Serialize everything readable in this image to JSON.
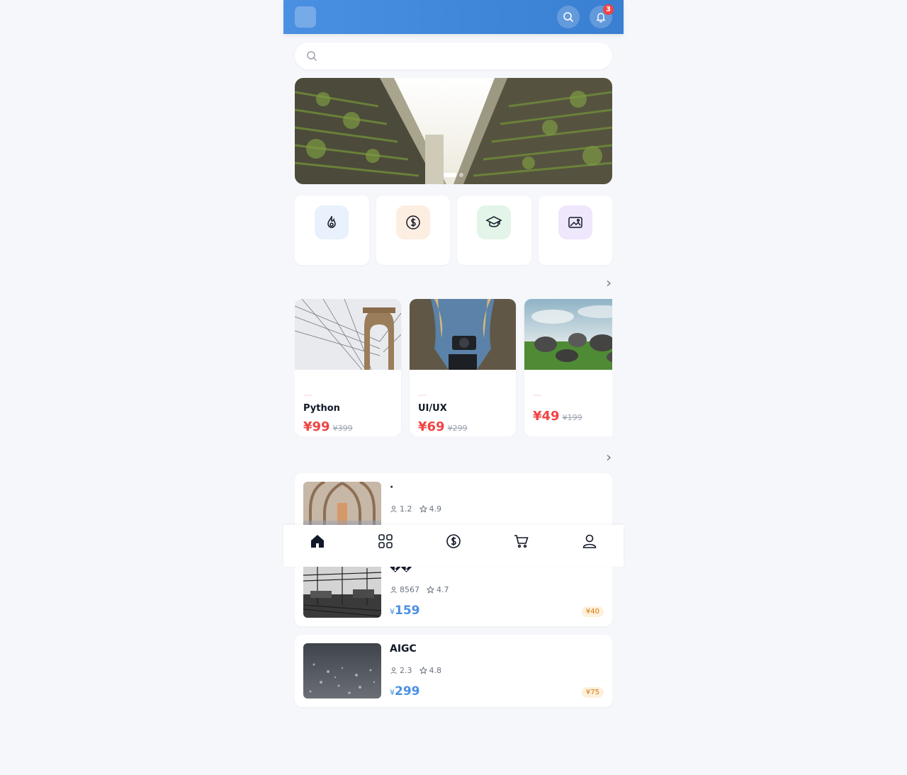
{
  "header": {
    "logo_glyph": "",
    "title": "",
    "notification_count": "3"
  },
  "search": {
    "placeholder": ""
  },
  "banner": {
    "dots": 2,
    "active_dot": 0
  },
  "categories": [
    {
      "label": "",
      "icon": "fire-icon",
      "bg": "#e8f1fc"
    },
    {
      "label": "",
      "icon": "dollar-circle-icon",
      "bg": "#fdeee2"
    },
    {
      "label": "",
      "icon": "graduation-cap-icon",
      "bg": "#e3f5e9"
    },
    {
      "label": "",
      "icon": "image-icon",
      "bg": "#efe7fb"
    }
  ],
  "hot_section": {
    "title_glyph": "",
    "title": "",
    "more": ""
  },
  "hot_courses": [
    {
      "tag": "",
      "title": "Python",
      "price": "¥99",
      "old_price": "¥399"
    },
    {
      "tag": "",
      "title": "UI/UX",
      "price": "¥69",
      "old_price": "¥299"
    },
    {
      "tag": "",
      "title": "",
      "price": "¥49",
      "old_price": "¥199"
    }
  ],
  "list_section": {
    "title_glyph": "",
    "title": "",
    "more": ""
  },
  "list_items": [
    {
      "title": " · ",
      "learners": "1.2",
      "rating": "4.9",
      "price": "",
      "coupon": ""
    },
    {
      "title": "��",
      "learners": "8567",
      "rating": "4.7",
      "price": "159",
      "coupon": "¥40"
    },
    {
      "title": "AIGC",
      "learners": "2.3",
      "rating": "4.8",
      "price": "299",
      "coupon": "¥75"
    }
  ],
  "price_currency": "¥",
  "bottom_nav": [
    {
      "label": "",
      "icon": "home-icon",
      "active": true
    },
    {
      "label": "",
      "icon": "grid-icon",
      "active": false
    },
    {
      "label": "",
      "icon": "dollar-circle-icon",
      "active": false
    },
    {
      "label": "",
      "icon": "cart-icon",
      "active": false
    },
    {
      "label": "",
      "icon": "user-icon",
      "active": false
    }
  ],
  "colors": {
    "primary": "#4a90e2",
    "price_red": "#ef4444",
    "coupon_orange": "#d97706",
    "page_bg": "#f5f7fb"
  }
}
